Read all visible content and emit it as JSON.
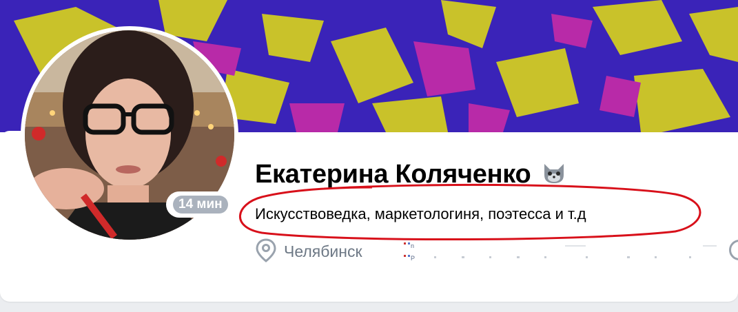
{
  "profile": {
    "name": "Екатерина Коляченко",
    "status": "Искусствоведка, маркетологиня, поэтесса и т.д",
    "last_seen": "14 мин",
    "city": "Челябинск"
  },
  "icons": {
    "status_emoji": "cat-emoji-icon",
    "location": "location-pin-icon",
    "work": "work-logo-icon"
  },
  "colors": {
    "cover_blue": "#3a23b8",
    "cover_yellow": "#c9c22a",
    "cover_magenta": "#b82aa8",
    "highlight_red": "#d8101a",
    "muted_text": "#6d7885",
    "badge_gray": "#aab2bd"
  }
}
